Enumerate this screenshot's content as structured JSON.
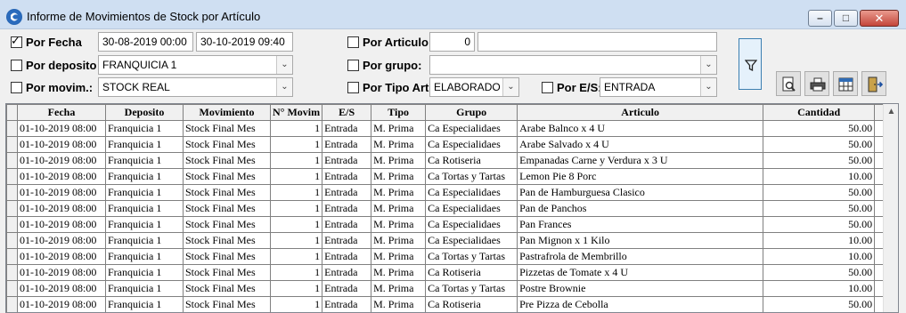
{
  "window": {
    "title": "Informe de Movimientos de Stock por Artículo",
    "minimize_glyph": "–",
    "maximize_glyph": "□",
    "close_glyph": "✕"
  },
  "filters": {
    "por_fecha": {
      "label": "Por Fecha",
      "checked": true,
      "checkmark": "✓",
      "from": "30-08-2019 00:00",
      "to": "30-10-2019 09:40"
    },
    "por_deposito": {
      "label": "Por deposito",
      "checked": false,
      "value": "FRANQUICIA 1"
    },
    "por_movim": {
      "label": "Por movim.:",
      "checked": false,
      "value": "STOCK REAL"
    },
    "por_articulo": {
      "label": "Por Articulo:",
      "checked": false,
      "code": "0",
      "name": ""
    },
    "por_grupo": {
      "label": "Por grupo:",
      "checked": false,
      "value": ""
    },
    "por_tipo_art": {
      "label": "Por Tipo Art.",
      "checked": false,
      "value": "ELABORADO"
    },
    "por_es": {
      "label": "Por E/S:",
      "checked": false,
      "value": "ENTRADA"
    },
    "dropdown_glyph": "⌄"
  },
  "toolbar": {
    "filter_icon": "funnel-icon",
    "preview_icon": "print-preview-icon",
    "print_icon": "printer-icon",
    "export_icon": "excel-export-icon",
    "exit_icon": "exit-door-icon"
  },
  "grid": {
    "columns": [
      "Fecha",
      "Deposito",
      "Movimiento",
      "N° Movim",
      "E/S",
      "Tipo",
      "Grupo",
      "Articulo",
      "Cantidad"
    ],
    "rows": [
      [
        "01-10-2019 08:00",
        "Franquicia 1",
        "Stock Final Mes",
        "1",
        "Entrada",
        "M. Prima",
        "Ca Especialidaes",
        "Arabe Balnco x 4 U",
        "50.00"
      ],
      [
        "01-10-2019 08:00",
        "Franquicia 1",
        "Stock Final Mes",
        "1",
        "Entrada",
        "M. Prima",
        "Ca Especialidaes",
        "Arabe Salvado x 4 U",
        "50.00"
      ],
      [
        "01-10-2019 08:00",
        "Franquicia 1",
        "Stock Final Mes",
        "1",
        "Entrada",
        "M. Prima",
        "Ca Rotiseria",
        "Empanadas Carne y Verdura x 3 U",
        "50.00"
      ],
      [
        "01-10-2019 08:00",
        "Franquicia 1",
        "Stock Final Mes",
        "1",
        "Entrada",
        "M. Prima",
        "Ca Tortas y Tartas",
        "Lemon Pie 8 Porc",
        "10.00"
      ],
      [
        "01-10-2019 08:00",
        "Franquicia 1",
        "Stock Final Mes",
        "1",
        "Entrada",
        "M. Prima",
        "Ca Especialidaes",
        "Pan de Hamburguesa Clasico",
        "50.00"
      ],
      [
        "01-10-2019 08:00",
        "Franquicia 1",
        "Stock Final Mes",
        "1",
        "Entrada",
        "M. Prima",
        "Ca Especialidaes",
        "Pan de Panchos",
        "50.00"
      ],
      [
        "01-10-2019 08:00",
        "Franquicia 1",
        "Stock Final Mes",
        "1",
        "Entrada",
        "M. Prima",
        "Ca Especialidaes",
        "Pan Frances",
        "50.00"
      ],
      [
        "01-10-2019 08:00",
        "Franquicia 1",
        "Stock Final Mes",
        "1",
        "Entrada",
        "M. Prima",
        "Ca Especialidaes",
        "Pan Mignon x 1 Kilo",
        "10.00"
      ],
      [
        "01-10-2019 08:00",
        "Franquicia 1",
        "Stock Final Mes",
        "1",
        "Entrada",
        "M. Prima",
        "Ca Tortas y Tartas",
        "Pastrafrola de Membrillo",
        "10.00"
      ],
      [
        "01-10-2019 08:00",
        "Franquicia 1",
        "Stock Final Mes",
        "1",
        "Entrada",
        "M. Prima",
        "Ca Rotiseria",
        "Pizzetas de Tomate x 4 U",
        "50.00"
      ],
      [
        "01-10-2019 08:00",
        "Franquicia 1",
        "Stock Final Mes",
        "1",
        "Entrada",
        "M. Prima",
        "Ca Tortas y Tartas",
        "Postre Brownie",
        "10.00"
      ],
      [
        "01-10-2019 08:00",
        "Franquicia 1",
        "Stock Final Mes",
        "1",
        "Entrada",
        "M. Prima",
        "Ca Rotiseria",
        "Pre Pizza de Cebolla",
        "50.00"
      ]
    ],
    "scroll_up_glyph": "▲"
  }
}
